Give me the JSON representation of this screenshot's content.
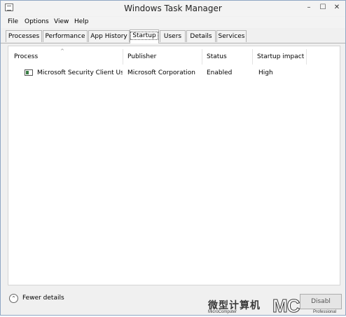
{
  "window": {
    "title": "Windows Task Manager",
    "controls": [
      "–",
      "☐",
      "✕"
    ]
  },
  "menu": [
    "File",
    "Options",
    "View",
    "Help"
  ],
  "tabs": [
    "Processes",
    "Performance",
    "App History",
    "Startup",
    "Users",
    "Details",
    "Services"
  ],
  "active_tab": "Startup",
  "table": {
    "columns": [
      "Process",
      "Publisher",
      "Status",
      "Startup impact"
    ],
    "rows": [
      [
        "Microsoft Security Client Us...",
        "Microsoft Corporation",
        "Enabled",
        "High"
      ]
    ]
  },
  "footer": {
    "fewer_details": "Fewer details",
    "disable": "Disabl",
    "toggle_icon": "chevron-up-icon"
  },
  "watermark": {
    "cn": "微型计算机",
    "mc": "MC",
    "sub": "MicroComputer",
    "sub2": "Professional"
  }
}
